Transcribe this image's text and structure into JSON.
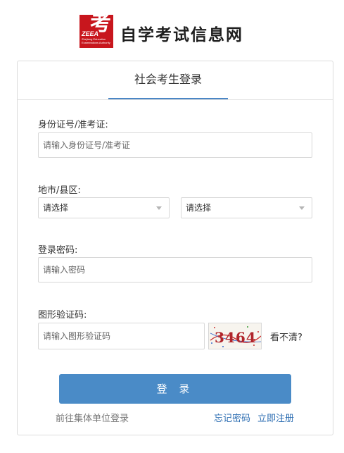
{
  "header": {
    "logo_glyph": "考",
    "logo_abbr": "ZEEA",
    "logo_subtitle": "Zhejiang Education Examinations Authority",
    "site_name": "自学考试信息网"
  },
  "tabs": [
    {
      "label": "社会考生登录",
      "active": true
    }
  ],
  "form": {
    "id_label": "身份证号/准考证:",
    "id_placeholder": "请输入身份证号/准考证",
    "region_label": "地市/县区:",
    "city_select": "请选择",
    "county_select": "请选择",
    "password_label": "登录密码:",
    "password_placeholder": "请输入密码",
    "captcha_label": "图形验证码:",
    "captcha_placeholder": "请输入图形验证码",
    "captcha_text": "3464",
    "refresh_link": "看不清?"
  },
  "actions": {
    "login_button": "登 录",
    "group_login": "前往集体单位登录",
    "forgot_password": "忘记密码",
    "register": "立即注册"
  },
  "colors": {
    "accent": "#4a8bc7",
    "logo_red": "#c8161d",
    "link_blue": "#2f6fb3",
    "muted_text": "#777777"
  }
}
